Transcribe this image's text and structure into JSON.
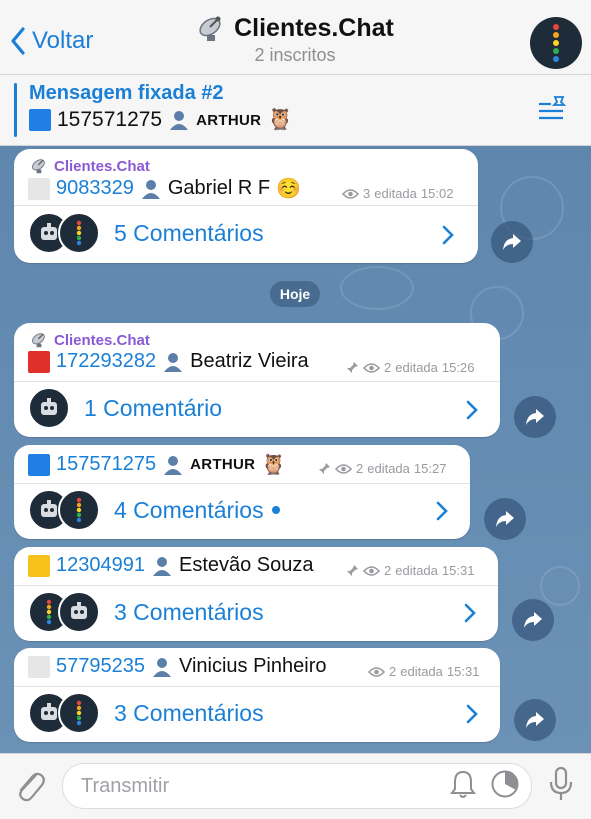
{
  "header": {
    "back_label": "Voltar",
    "title": "Clientes.Chat",
    "subtitle": "2 inscritos",
    "avatar_colors": [
      "#e8463c",
      "#f3a51d",
      "#fbd428",
      "#2fb04f",
      "#2e86de"
    ]
  },
  "pinned": {
    "title": "Mensagem fixada #2",
    "number": "157571275",
    "name": "ARTHUR",
    "emoji": "🦉",
    "square_color": "#1f7fe5"
  },
  "date_separator": "Hoje",
  "messages": [
    {
      "sender": "Clientes.Chat",
      "square_color": "#e6e6e6",
      "number": "9083329",
      "name": "Gabriel R F",
      "emoji": "☺️",
      "views": "3",
      "edited": "editada",
      "time": "15:02",
      "pinned": false,
      "comments": "5 Comentários",
      "avatars": 2,
      "unread_dot": false
    },
    {
      "sender": "Clientes.Chat",
      "square_color": "#e0302a",
      "number": "172293282",
      "name": "Beatriz Vieira",
      "emoji": "",
      "views": "2",
      "edited": "editada",
      "time": "15:26",
      "pinned": true,
      "comments": "1 Comentário",
      "avatars": 1,
      "unread_dot": false
    },
    {
      "sender": "",
      "square_color": "#1f7fe5",
      "number": "157571275",
      "name": "ARTHUR",
      "emoji": "🦉",
      "views": "2",
      "edited": "editada",
      "time": "15:27",
      "pinned": true,
      "comments": "4 Comentários",
      "avatars": 2,
      "unread_dot": true
    },
    {
      "sender": "",
      "square_color": "#f6c21b",
      "number": "12304991",
      "name": "Estevão Souza",
      "emoji": "",
      "views": "2",
      "edited": "editada",
      "time": "15:31",
      "pinned": true,
      "comments": "3 Comentários",
      "avatars": 2,
      "unread_dot": false
    },
    {
      "sender": "",
      "square_color": "#e6e6e6",
      "number": "57795235",
      "name": "Vinicius Pinheiro",
      "emoji": "",
      "views": "2",
      "edited": "editada",
      "time": "15:31",
      "pinned": false,
      "comments": "3 Comentários",
      "avatars": 2,
      "unread_dot": false
    }
  ],
  "composer": {
    "placeholder": "Transmitir"
  },
  "colors": {
    "accent": "#1a7fd6",
    "sender": "#8a5ad6",
    "chat_background": "#6a8fb5"
  }
}
